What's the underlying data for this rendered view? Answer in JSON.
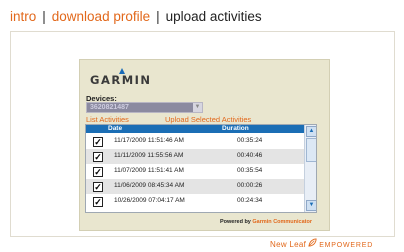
{
  "nav": {
    "intro": "intro",
    "sep": "|",
    "download_profile": "download profile",
    "upload_activities": "upload activities"
  },
  "garmin": {
    "logo_text": "GARMIN",
    "devices_label": "Devices:",
    "device_value": "3620821487",
    "list_activities": "List Activities",
    "upload_selected": "Upload Selected Activities",
    "columns": {
      "date": "Date",
      "duration": "Duration"
    },
    "rows": [
      {
        "date": "11/17/2009 11:51:46 AM",
        "duration": "00:35:24",
        "checked": true
      },
      {
        "date": "11/11/2009 11:55:56 AM",
        "duration": "00:40:46",
        "checked": true
      },
      {
        "date": "11/07/2009 11:51:41 AM",
        "duration": "00:35:54",
        "checked": true
      },
      {
        "date": "11/06/2009 08:45:34 AM",
        "duration": "00:00:26",
        "checked": true
      },
      {
        "date": "10/26/2009 07:04:17 AM",
        "duration": "00:24:34",
        "checked": true
      }
    ],
    "powered_prefix": "Powered by",
    "powered_brand": "Garmin Communicator"
  },
  "footer": {
    "brand_part1": "New Leaf",
    "brand_part2": "EMPOWERED"
  },
  "colors": {
    "accent": "#e2681b",
    "table_header": "#1b6eb5",
    "panel_bg": "#e9e6cf"
  }
}
